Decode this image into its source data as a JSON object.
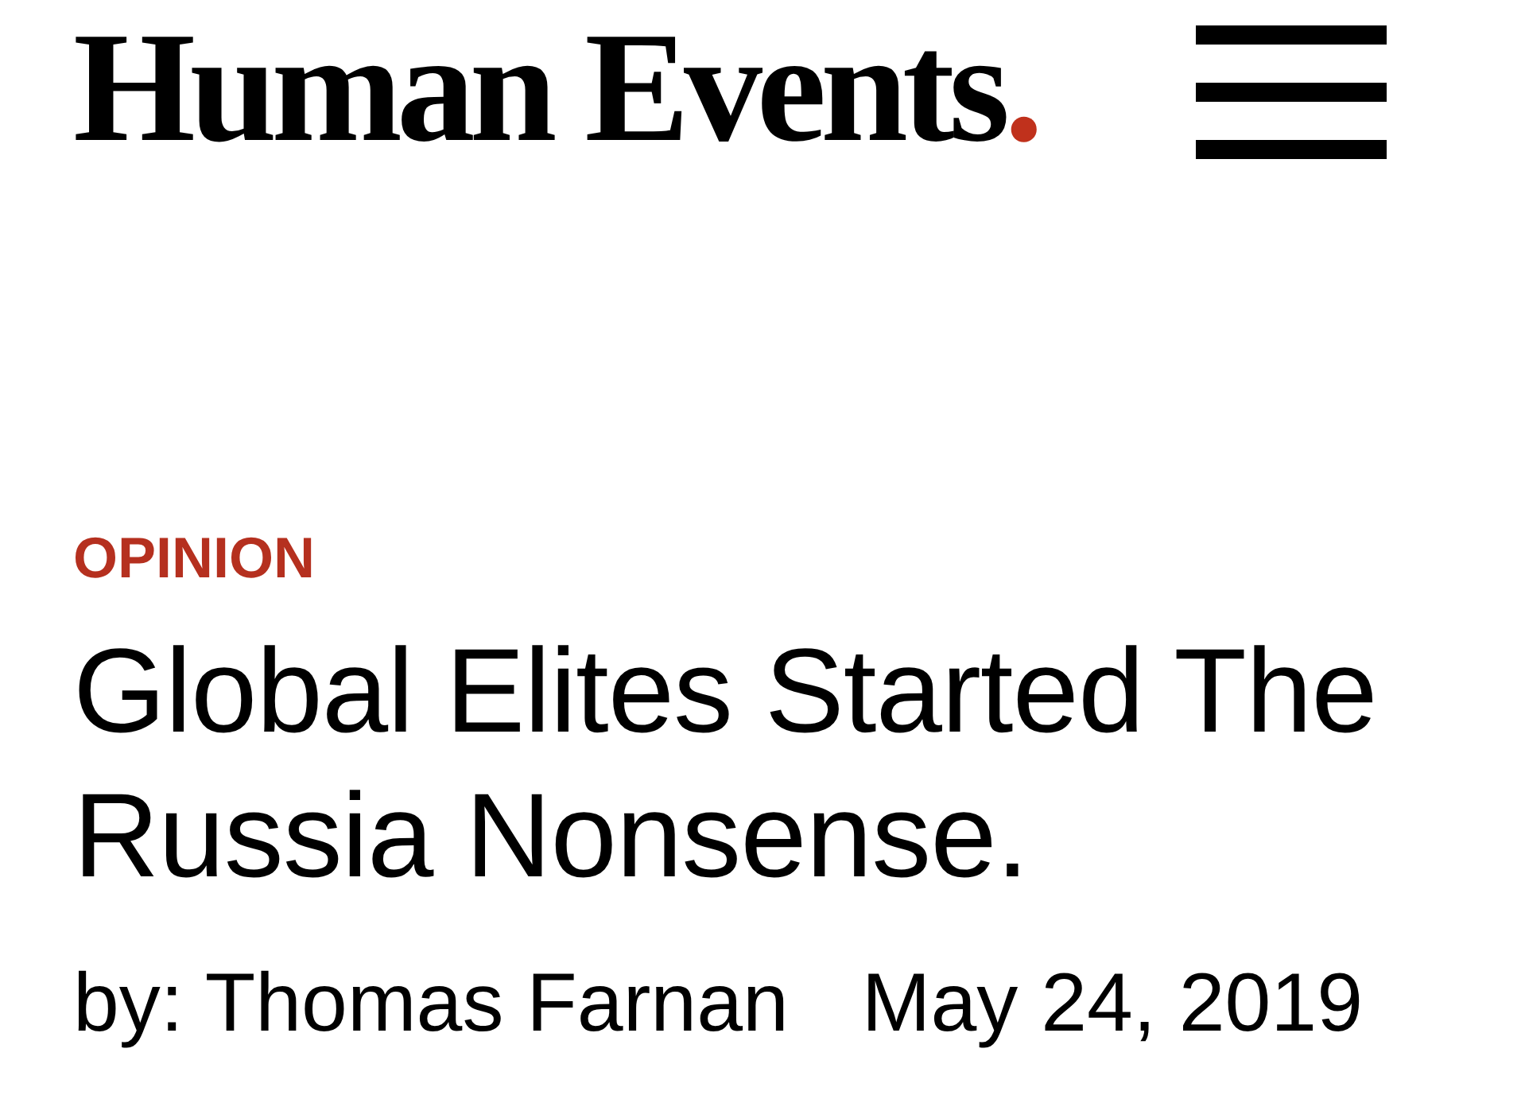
{
  "header": {
    "logo": {
      "text": "Human Events",
      "mark": "."
    }
  },
  "article": {
    "category": "OPINION",
    "title": "Global Elites Started The Russia Nonsense.",
    "byline": "by: Thomas Farnan",
    "date": "May 24, 2019"
  }
}
